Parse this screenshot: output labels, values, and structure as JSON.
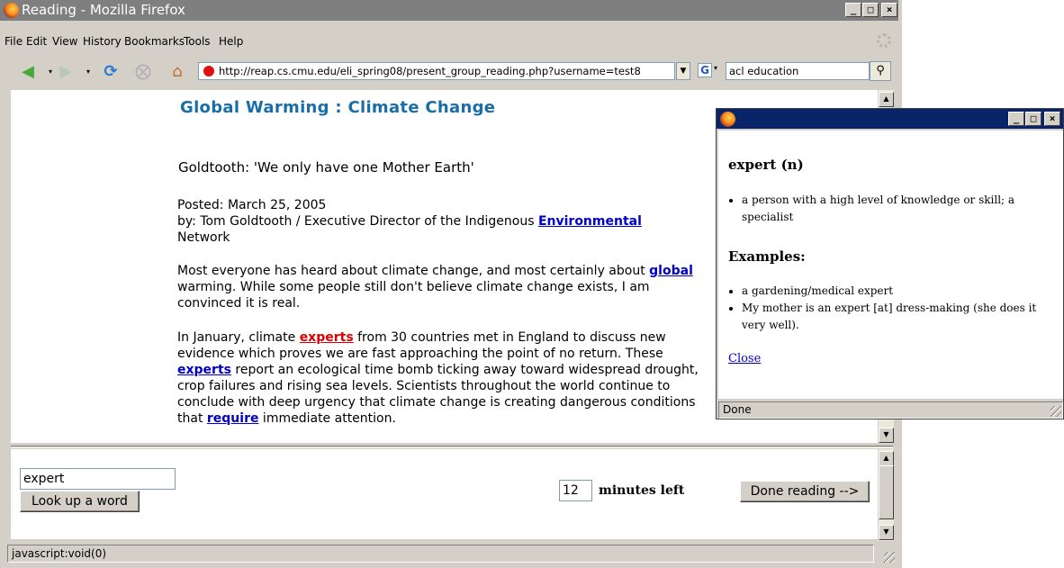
{
  "browser": {
    "title": "Reading - Mozilla Firefox",
    "menu": [
      "File",
      "Edit",
      "View",
      "History",
      "Bookmarks",
      "Tools",
      "Help"
    ],
    "url": "http://reap.cs.cmu.edu/eli_spring08/present_group_reading.php?username=test8",
    "search_value": "acl education",
    "status": "javascript:void(0)"
  },
  "article": {
    "title": "Global Warming : Climate Change",
    "subtitle": "Goldtooth: 'We only have one Mother Earth'",
    "posted": "Posted: March 25, 2005",
    "byline_pre": "by: Tom Goldtooth / Executive Director of the Indigenous ",
    "byline_link": "Environmental",
    "byline_post": "Network",
    "p1_pre": "Most everyone has heard about climate change, and most certainly about ",
    "p1_link": "global",
    "p1_post": " warming. While some people still don't believe climate change exists, I am convinced it is real.",
    "p2_a": "In January, climate ",
    "p2_link1": "experts",
    "p2_b": " from 30 countries met in England to discuss new evidence which proves we are fast approaching the point of no return. These ",
    "p2_link2": "experts",
    "p2_c": " report an ecological time bomb ticking away toward widespread drought, crop failures and rising sea levels. Scientists throughout the world continue to conclude with deep urgency that climate change is creating dangerous conditions that ",
    "p2_link3": "require",
    "p2_d": " immediate attention."
  },
  "controls": {
    "word_value": "expert",
    "lookup_label": "Look up a word",
    "minutes_value": "12",
    "minutes_label": "minutes left",
    "done_label": "Done reading -->"
  },
  "popup": {
    "headword": "expert (n)",
    "definitions": [
      "a person with a high level of knowledge or skill; a specialist"
    ],
    "examples_heading": "Examples:",
    "examples": [
      "a gardening/medical expert",
      "My mother is an expert [at] dress-making (she does it very well)."
    ],
    "close_label": "Close",
    "status": "Done"
  },
  "colors": {
    "title_inactive": "#7f7f7f",
    "title_active": "#0a246a",
    "article_title": "#1a6ea8",
    "link": "#0000cc",
    "link_highlight": "#e00000"
  }
}
